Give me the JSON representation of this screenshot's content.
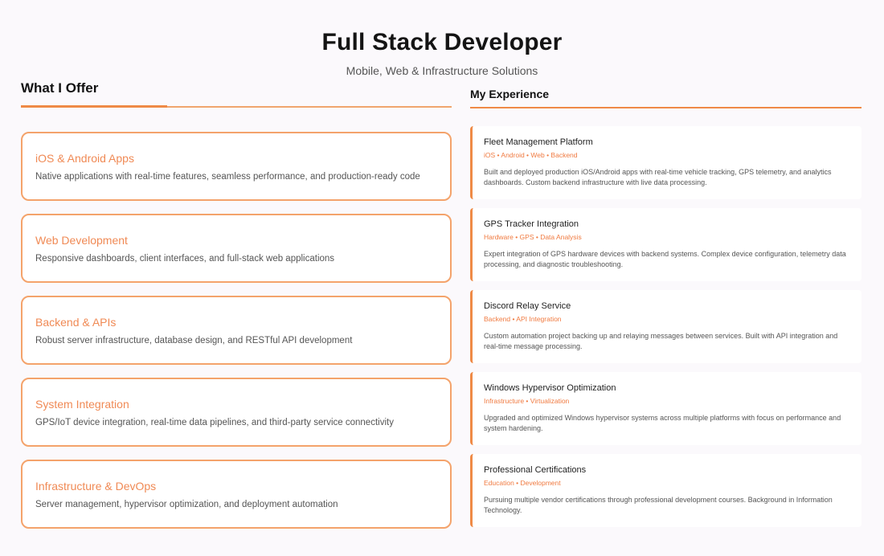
{
  "header": {
    "title": "Full Stack Developer",
    "subtitle": "Mobile, Web & Infrastructure Solutions"
  },
  "offer": {
    "heading": "What I Offer",
    "items": [
      {
        "title": "iOS & Android Apps",
        "desc": "Native applications with real-time features, seamless performance, and production-ready code"
      },
      {
        "title": "Web Development",
        "desc": "Responsive dashboards, client interfaces, and full-stack web applications"
      },
      {
        "title": "Backend & APIs",
        "desc": "Robust server infrastructure, database design, and RESTful API development"
      },
      {
        "title": "System Integration",
        "desc": "GPS/IoT device integration, real-time data pipelines, and third-party service connectivity"
      },
      {
        "title": "Infrastructure & DevOps",
        "desc": "Server management, hypervisor optimization, and deployment automation"
      }
    ]
  },
  "experience": {
    "heading": "My Experience",
    "items": [
      {
        "title": "Fleet Management Platform",
        "tags": "iOS • Android • Web • Backend",
        "desc": "Built and deployed production iOS/Android apps with real-time vehicle tracking, GPS telemetry, and analytics dashboards. Custom backend infrastructure with live data processing."
      },
      {
        "title": "GPS Tracker Integration",
        "tags": "Hardware • GPS • Data Analysis",
        "desc": "Expert integration of GPS hardware devices with backend systems. Complex device configuration, telemetry data processing, and diagnostic troubleshooting."
      },
      {
        "title": "Discord Relay Service",
        "tags": "Backend • API Integration",
        "desc": "Custom automation project backing up and relaying messages between services. Built with API integration and real-time message processing."
      },
      {
        "title": "Windows Hypervisor Optimization",
        "tags": "Infrastructure • Virtualization",
        "desc": "Upgraded and optimized Windows hypervisor systems across multiple platforms with focus on performance and system hardening."
      },
      {
        "title": "Professional Certifications",
        "tags": "Education • Development",
        "desc": "Pursuing multiple vendor certifications through professional development courses. Background in Information Technology."
      }
    ]
  },
  "colors": {
    "accent": "#ef8a46",
    "card_border": "#f4a36b",
    "background": "#fbf9fc"
  }
}
